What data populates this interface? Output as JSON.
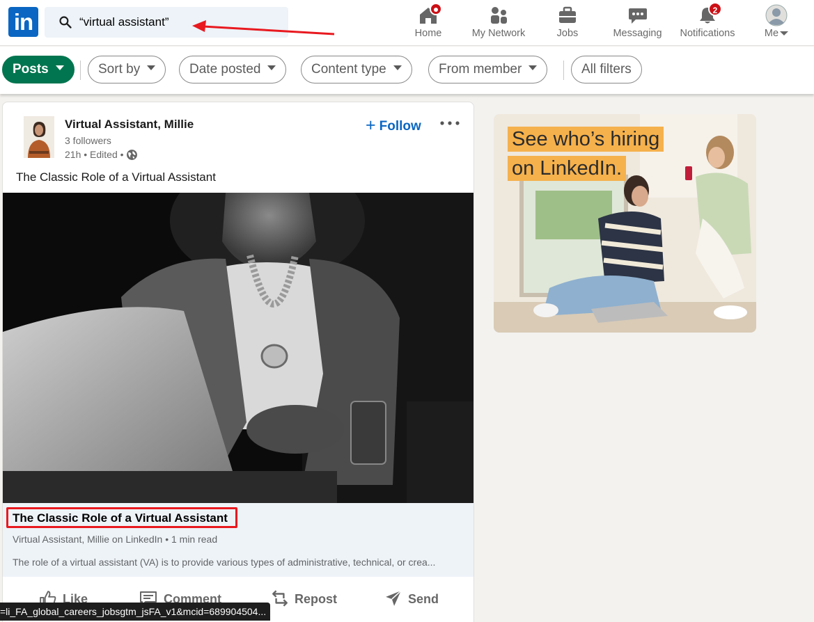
{
  "search": {
    "query": "“virtual assistant”"
  },
  "nav": {
    "home": "Home",
    "network": "My Network",
    "jobs": "Jobs",
    "messaging": "Messaging",
    "notifications": "Notifications",
    "notifications_count": "2",
    "me": "Me"
  },
  "filters": {
    "posts": "Posts",
    "sort_by": "Sort by",
    "date_posted": "Date posted",
    "content_type": "Content type",
    "from_member": "From member",
    "all_filters": "All filters"
  },
  "post": {
    "author": "Virtual Assistant, Millie",
    "followers": "3 followers",
    "meta": "21h • Edited •",
    "follow_label": "Follow",
    "text": "The Classic Role of a Virtual Assistant",
    "article": {
      "title": "The Classic Role of a Virtual Assistant",
      "subtitle": "Virtual Assistant, Millie on LinkedIn • 1 min read",
      "description": "The role of a virtual assistant (VA) is to provide various types of administrative, technical, or crea..."
    },
    "actions": {
      "like": "Like",
      "comment": "Comment",
      "repost": "Repost",
      "send": "Send"
    }
  },
  "ad": {
    "line1": "See who’s hiring",
    "line2": "on LinkedIn."
  },
  "status_url": "=li_FA_global_careers_jobsgtm_jsFA_v1&mcid=689904504...",
  "colors": {
    "brand": "#0a66c2",
    "posts_pill": "#01754f",
    "badge": "#cc1016",
    "annotation": "#e8191f",
    "ad_highlight": "#f5b14c"
  }
}
